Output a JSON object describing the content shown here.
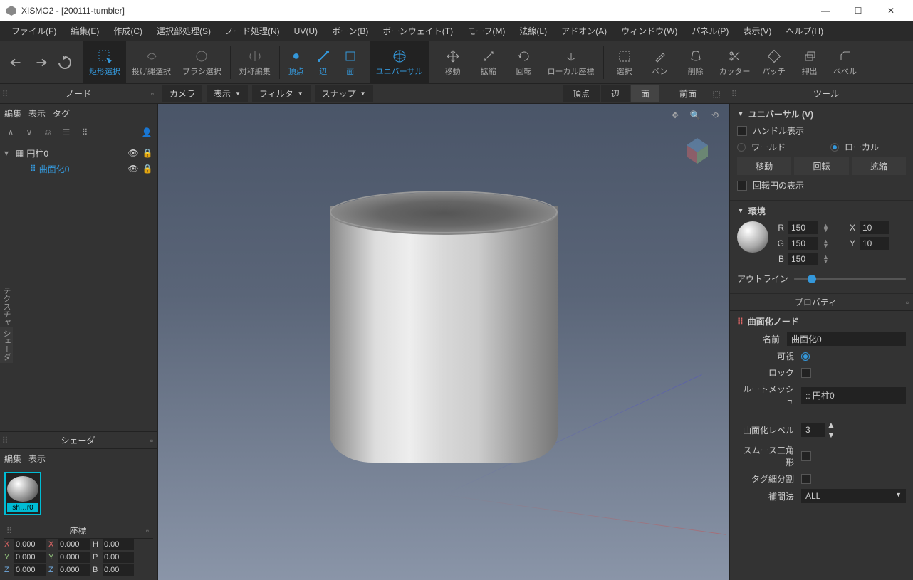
{
  "app": {
    "title": "XISMO2 - [200111-tumbler]"
  },
  "menu": {
    "file": "ファイル(F)",
    "edit": "編集(E)",
    "create": "作成(C)",
    "selproc": "選択部処理(S)",
    "nodeproc": "ノード処理(N)",
    "uv": "UV(U)",
    "bone": "ボーン(B)",
    "boneweight": "ボーンウェイト(T)",
    "morph": "モーフ(M)",
    "normal": "法線(L)",
    "addon": "アドオン(A)",
    "window": "ウィンドウ(W)",
    "panel": "パネル(P)",
    "display": "表示(V)",
    "help": "ヘルプ(H)"
  },
  "toolbar": {
    "rect_select": "矩形選択",
    "lasso_select": "投げ縄選択",
    "brush_select": "ブラシ選択",
    "sym_edit": "対称編集",
    "vertex": "頂点",
    "edge": "辺",
    "face": "面",
    "universal": "ユニバーサル",
    "move": "移動",
    "scale": "拡縮",
    "rotate": "回転",
    "local_coord": "ローカル座標",
    "select": "選択",
    "pen": "ペン",
    "delete": "削除",
    "cutter": "カッター",
    "patch": "パッチ",
    "extrude": "押出",
    "bevel": "ベベル"
  },
  "secbar": {
    "node_title": "ノード",
    "camera": "カメラ",
    "display": "表示",
    "filter": "フィルタ",
    "snap": "スナップ",
    "vertex": "頂点",
    "edge": "辺",
    "face": "面",
    "front": "前面",
    "tool_title": "ツール"
  },
  "left": {
    "edit": "編集",
    "display": "表示",
    "tag": "タグ",
    "tree": {
      "root": "円柱0",
      "child": "曲面化0"
    },
    "shader_title": "シェーダ",
    "shader_edit": "編集",
    "shader_display": "表示",
    "shader_thumb": "sh…r0",
    "coord_title": "座標",
    "coords": {
      "x": "0.000",
      "y": "0.000",
      "z": "0.000",
      "x2": "0.000",
      "y2": "0.000",
      "z2": "0.000",
      "h": "0.00",
      "p": "0.00",
      "b": "0.00"
    },
    "side_texture": "テクスチャ",
    "side_shader": "シェーダ"
  },
  "right": {
    "universal_title": "ユニバーサル (V)",
    "handle_display": "ハンドル表示",
    "world": "ワールド",
    "local": "ローカル",
    "move": "移動",
    "rotate": "回転",
    "scale": "拡縮",
    "rot_circle": "回転円の表示",
    "env_title": "環境",
    "r": "R",
    "g": "G",
    "b": "B",
    "r_val": "150",
    "g_val": "150",
    "b_val": "150",
    "x": "X",
    "y": "Y",
    "x_val": "10",
    "y_val": "10",
    "outline": "アウトライン",
    "property": "プロパティ",
    "node_title": "曲面化ノード",
    "name_lbl": "名前",
    "name_val": "曲面化0",
    "visible_lbl": "可視",
    "lock_lbl": "ロック",
    "rootmesh_lbl": "ルートメッシュ",
    "rootmesh_val": ":: 円柱0",
    "subdiv_lbl": "曲面化レベル",
    "subdiv_val": "3",
    "smooth_tri": "スムース三角形",
    "tag_subdiv": "タグ細分割",
    "interp_lbl": "補間法",
    "interp_val": "ALL"
  }
}
